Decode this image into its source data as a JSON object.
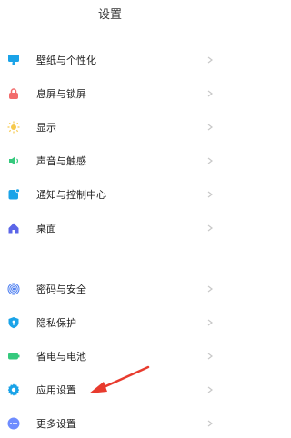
{
  "header": {
    "title": "设置"
  },
  "groups": [
    {
      "items": [
        {
          "label": "壁纸与个性化",
          "icon": "wallpaper-icon",
          "color": "#1AA3E8"
        },
        {
          "label": "息屏与锁屏",
          "icon": "lock-icon",
          "color": "#F26B6B"
        },
        {
          "label": "显示",
          "icon": "brightness-icon",
          "color": "#F6C94C"
        },
        {
          "label": "声音与触感",
          "icon": "speaker-icon",
          "color": "#35C97D"
        },
        {
          "label": "通知与控制中心",
          "icon": "notification-icon",
          "color": "#1AA3E8"
        },
        {
          "label": "桌面",
          "icon": "home-icon",
          "color": "#5B66E8"
        }
      ]
    },
    {
      "items": [
        {
          "label": "密码与安全",
          "icon": "fingerprint-icon",
          "color": "#4A7CF0"
        },
        {
          "label": "隐私保护",
          "icon": "privacy-icon",
          "color": "#1AA3E8"
        },
        {
          "label": "省电与电池",
          "icon": "battery-icon",
          "color": "#35C97D"
        },
        {
          "label": "应用设置",
          "icon": "gear-icon",
          "color": "#1AA3E8"
        },
        {
          "label": "更多设置",
          "icon": "more-icon",
          "color": "#6E8CFF"
        }
      ]
    }
  ],
  "annotation": {
    "arrow_color": "#E83B2E"
  }
}
